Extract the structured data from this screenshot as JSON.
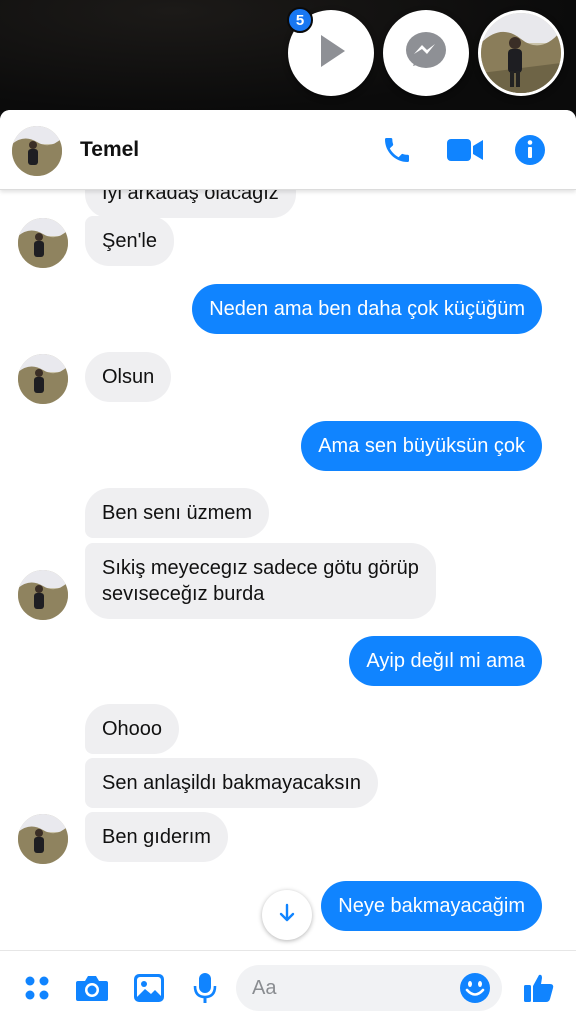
{
  "chat_heads": {
    "badge_count": "5",
    "items": [
      {
        "icon": "play-icon"
      },
      {
        "icon": "messenger-icon"
      },
      {
        "icon": "contact-avatar"
      }
    ]
  },
  "header": {
    "contact_name": "Temel",
    "icons": [
      "phone-icon",
      "video-camera-icon",
      "info-icon"
    ]
  },
  "messages": [
    {
      "side": "in",
      "text": "Iyi arkadaş olacağız"
    },
    {
      "side": "in",
      "text": "Şen'le"
    },
    {
      "side": "out",
      "text": "Neden ama ben daha çok küçüğüm"
    },
    {
      "side": "in",
      "text": "Olsun"
    },
    {
      "side": "out",
      "text": "Ama sen büyüksün çok"
    },
    {
      "side": "in",
      "text": "Ben senı üzmem"
    },
    {
      "side": "in",
      "text": "Sıkiş meyecegız sadece götu görüp",
      "text2": "sevıseceğız burda"
    },
    {
      "side": "out",
      "text": "Ayip değıl mi ama"
    },
    {
      "side": "in",
      "text": "Ohooo"
    },
    {
      "side": "in",
      "text": "Sen anlaşildı  bakmayacaksın"
    },
    {
      "side": "in",
      "text": "Ben gıderım"
    },
    {
      "side": "out",
      "text": "Neye bakmayacağim"
    }
  ],
  "composer": {
    "placeholder": "Aa",
    "icons": [
      "apps-grid-icon",
      "camera-icon",
      "image-icon",
      "microphone-icon",
      "emoji-icon",
      "thumbs-up-icon"
    ]
  },
  "colors": {
    "accent": "#1084ff",
    "incoming_bubble": "#efeff1",
    "badge": "#1877f2"
  }
}
